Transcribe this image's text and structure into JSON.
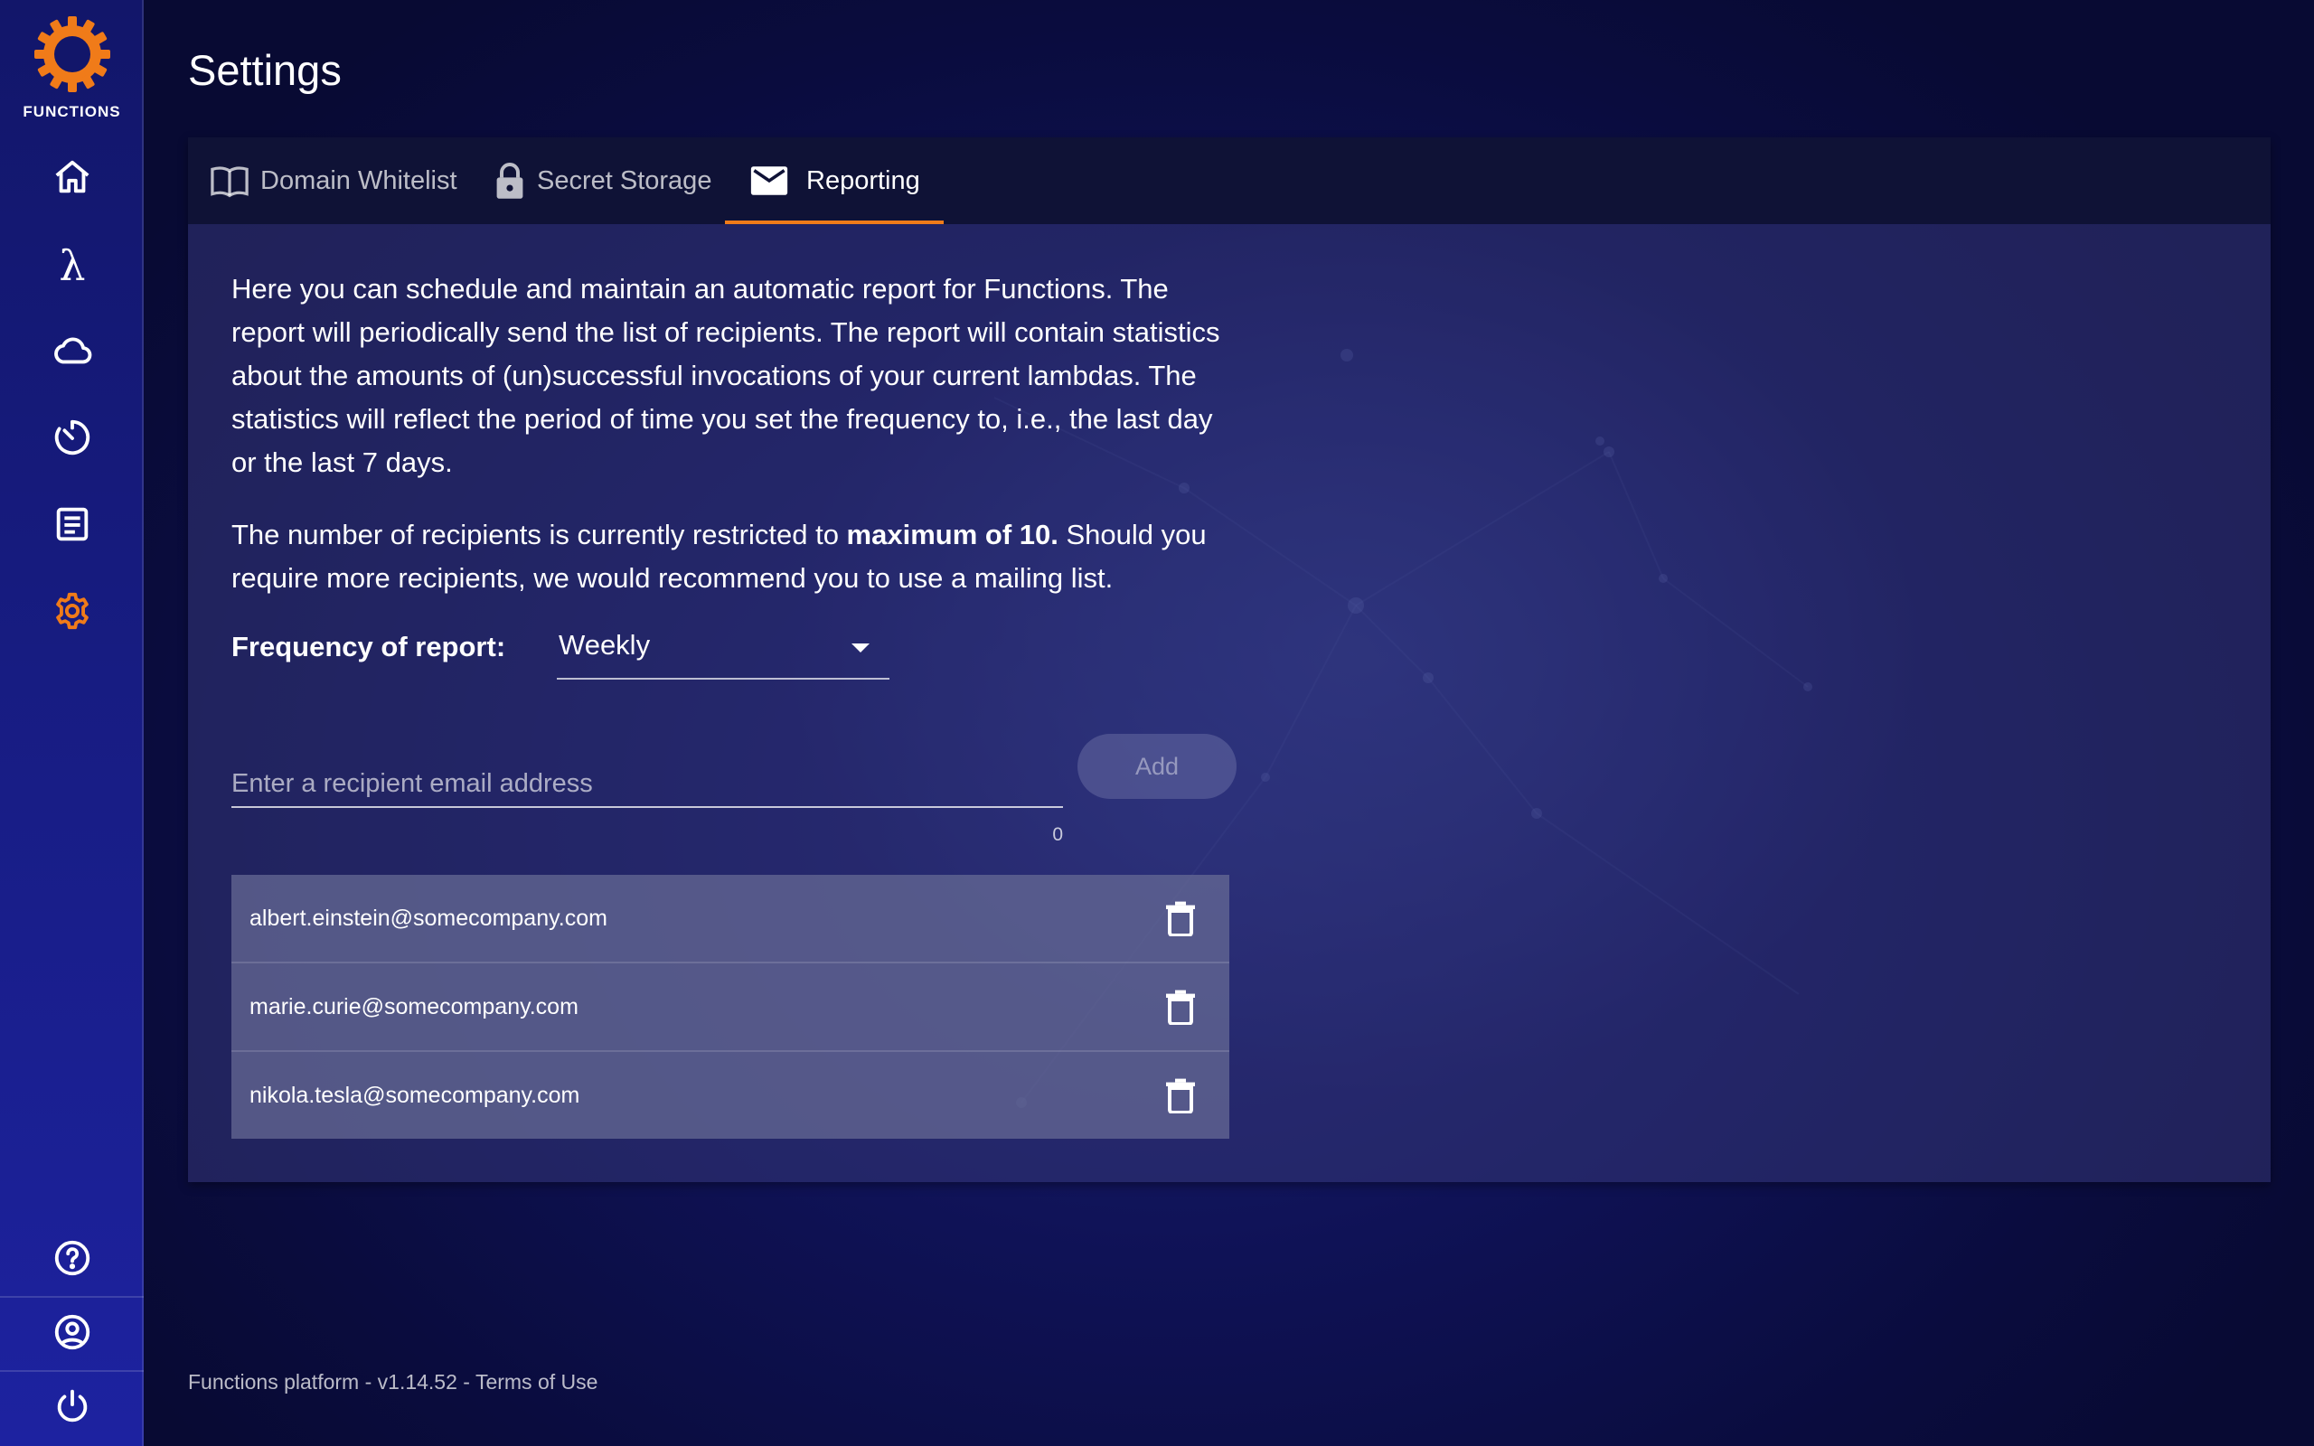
{
  "app": {
    "logo_text": "FUNCTIONS",
    "accent_color": "#f07b19"
  },
  "sidebar": {
    "items": [
      {
        "name": "home",
        "icon": "home-icon"
      },
      {
        "name": "functions",
        "icon": "lambda-icon",
        "glyph": "λ"
      },
      {
        "name": "cloud",
        "icon": "cloud-icon"
      },
      {
        "name": "timer",
        "icon": "timer-icon"
      },
      {
        "name": "logs",
        "icon": "document-icon"
      },
      {
        "name": "settings",
        "icon": "gear-icon",
        "active": true
      }
    ],
    "bottom_items": [
      {
        "name": "help",
        "icon": "help-icon"
      },
      {
        "name": "account",
        "icon": "account-icon"
      },
      {
        "name": "logout",
        "icon": "power-icon"
      }
    ]
  },
  "page": {
    "title": "Settings"
  },
  "tabs": [
    {
      "label": "Domain Whitelist",
      "icon": "book-icon"
    },
    {
      "label": "Secret Storage",
      "icon": "lock-icon"
    },
    {
      "label": "Reporting",
      "icon": "mail-icon",
      "active": true
    }
  ],
  "reporting": {
    "intro": "Here you can schedule and maintain an automatic report for Functions. The report will periodically send the list of recipients. The report will contain statistics about the amounts of (un)successful invocations of your current lambdas. The statistics will reflect the period of time you set the frequency to, i.e., the last day or the last 7 days.",
    "restriction_prefix": "The number of recipients is currently restricted to ",
    "restriction_bold": "maximum of 10.",
    "restriction_suffix": " Should you require more recipients, we would recommend you to use a mailing list.",
    "frequency_label": "Frequency of report:",
    "frequency_value": "Weekly",
    "email_placeholder": "Enter a recipient email address",
    "email_value": "",
    "char_count": "0",
    "add_label": "Add",
    "recipients": [
      "albert.einstein@somecompany.com",
      "marie.curie@somecompany.com",
      "nikola.tesla@somecompany.com"
    ]
  },
  "footer": {
    "platform": "Functions platform",
    "separator": " - ",
    "version": "v1.14.52",
    "terms": "Terms of Use"
  }
}
